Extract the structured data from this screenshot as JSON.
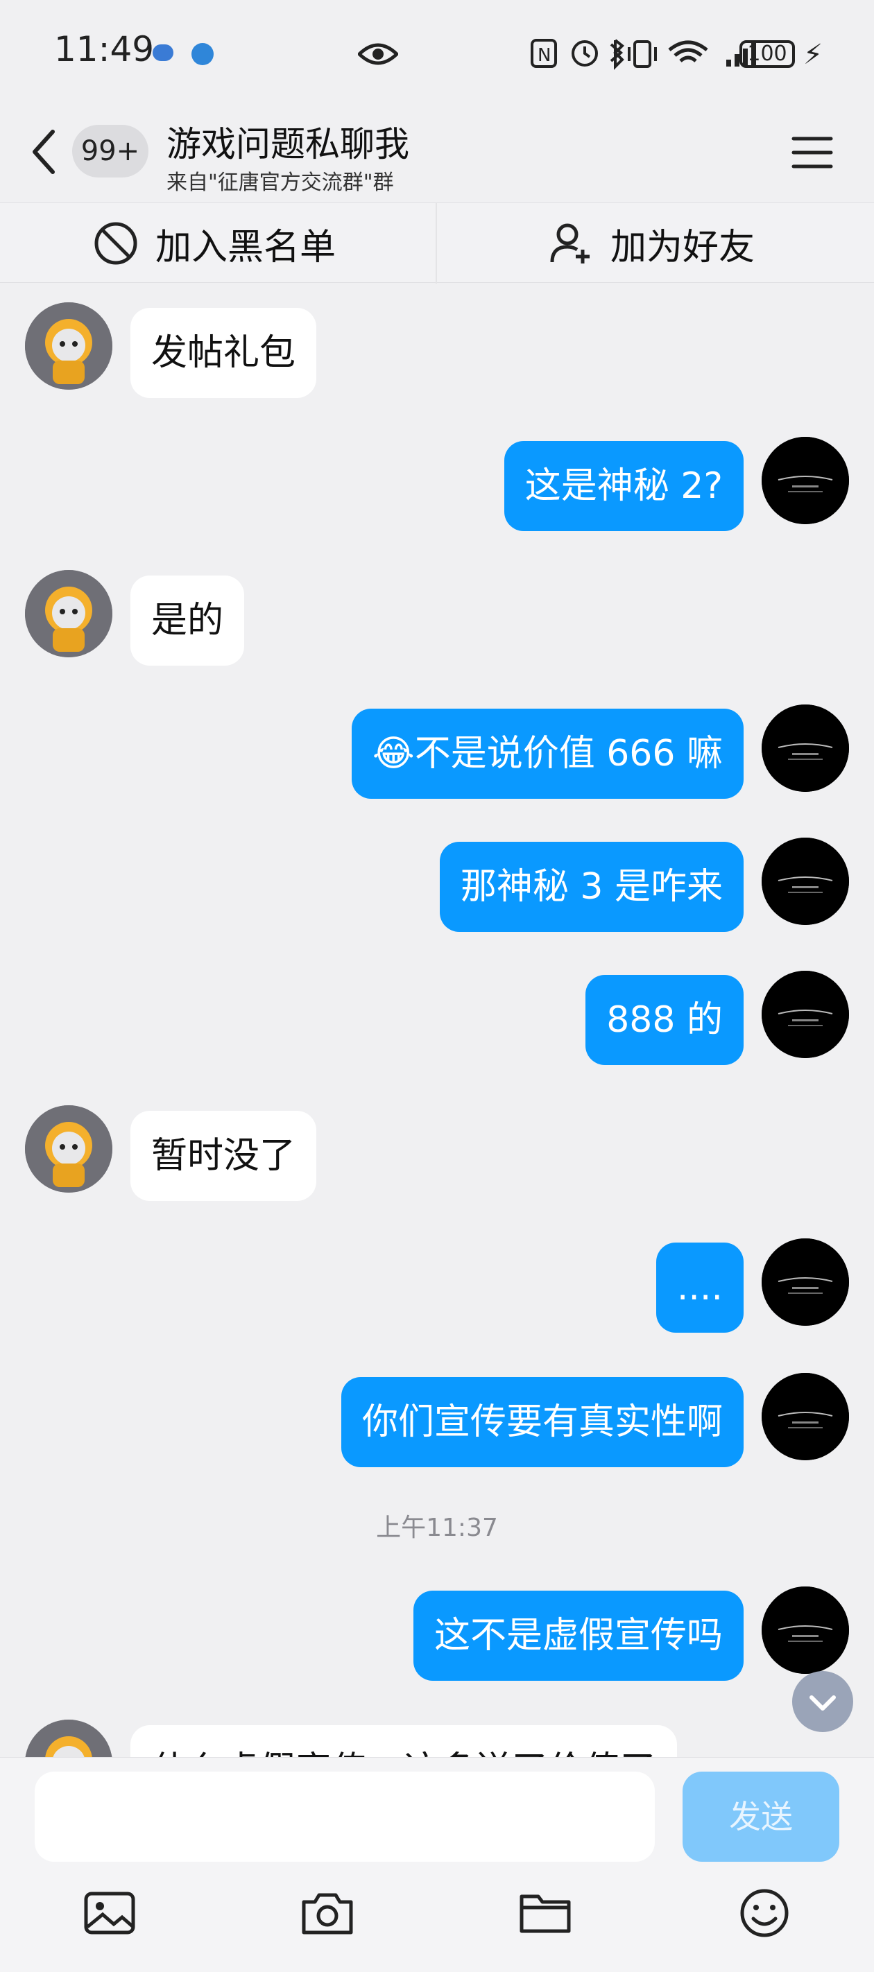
{
  "status_bar": {
    "time": "11:49",
    "battery": "100"
  },
  "header": {
    "unread_count": "99+",
    "title": "游戏问题私聊我",
    "subtitle": "来自\"征唐官方交流群\"群"
  },
  "actions": {
    "block": "加入黑名单",
    "add_friend": "加为好友"
  },
  "messages": [
    {
      "side": "in",
      "text": "发帖礼包"
    },
    {
      "side": "out",
      "text": "这是神秘 2?"
    },
    {
      "side": "in",
      "text": "是的"
    },
    {
      "side": "out",
      "emoji": "😂",
      "text": "不是说价值 666 嘛"
    },
    {
      "side": "out",
      "text": "那神秘 3 是咋来"
    },
    {
      "side": "out",
      "text": "888 的"
    },
    {
      "side": "in",
      "text": "暂时没了"
    },
    {
      "side": "out",
      "text": "...."
    },
    {
      "side": "out",
      "text": "你们宣传要有真实性啊"
    },
    {
      "side": "out",
      "text": "这不是虚假宣传吗"
    },
    {
      "side": "in",
      "text": "什么虚假宣传，这多送了价值了"
    }
  ],
  "timestamp": "上午11:37",
  "composer": {
    "send_label": "发送",
    "icons": [
      "image-icon",
      "camera-icon",
      "folder-icon",
      "emoji-icon"
    ]
  },
  "colors": {
    "outgoing_bubble": "#0a99ff",
    "send_disabled": "#80c8fb"
  }
}
